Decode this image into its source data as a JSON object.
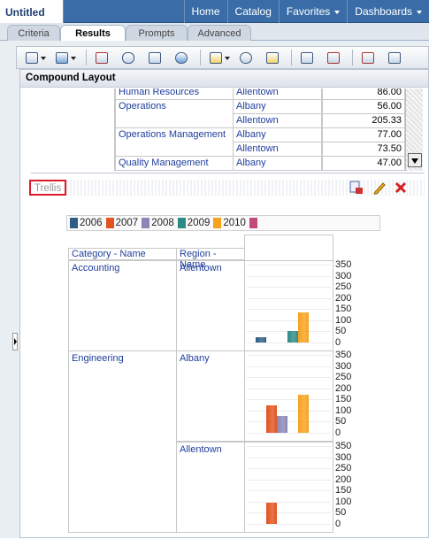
{
  "header": {
    "doc_title": "Untitled",
    "nav": [
      "Home",
      "Catalog",
      "Favorites",
      "Dashboards"
    ]
  },
  "tabs": [
    "Criteria",
    "Results",
    "Prompts",
    "Advanced"
  ],
  "compound": {
    "title": "Compound Layout",
    "rows": [
      {
        "category": "Human Resources",
        "region": "Allentown",
        "value": "86.00"
      },
      {
        "category": "Operations",
        "region": "Albany",
        "value": "56.00"
      },
      {
        "category": "",
        "region": "Allentown",
        "value": "205.33"
      },
      {
        "category": "Operations Management",
        "region": "Albany",
        "value": "77.00"
      },
      {
        "category": "",
        "region": "Allentown",
        "value": "73.50"
      },
      {
        "category": "Quality Management",
        "region": "Albany",
        "value": "47.00"
      }
    ]
  },
  "trellis": {
    "label": "Trellis",
    "legend": [
      "2006",
      "2007",
      "2008",
      "2009",
      "2010"
    ],
    "headers": {
      "category": "Category - Name",
      "region": "Region - Name"
    },
    "axis_ticks": [
      "350",
      "300",
      "250",
      "200",
      "150",
      "100",
      "50",
      "0"
    ],
    "cells": [
      {
        "category": "Accounting",
        "region": "Allentown"
      },
      {
        "category": "Engineering",
        "region": "Albany"
      },
      {
        "category": "",
        "region": "Allentown"
      }
    ]
  },
  "colors": {
    "y2006": "#2f5c86",
    "y2007": "#e2531f",
    "y2008": "#8a86b6",
    "y2009": "#2d8b85",
    "y2010": "#f7a11c",
    "y2011": "#c24a7a"
  },
  "chart_data": [
    {
      "type": "bar",
      "categories": [
        "2006",
        "2007",
        "2008",
        "2009",
        "2010"
      ],
      "series": [
        {
          "values": [
            25,
            0,
            0,
            50,
            135
          ]
        }
      ],
      "ylim": [
        0,
        350
      ]
    },
    {
      "type": "bar",
      "categories": [
        "2006",
        "2007",
        "2008",
        "2009",
        "2010"
      ],
      "series": [
        {
          "values": [
            0,
            125,
            75,
            0,
            170
          ]
        }
      ],
      "ylim": [
        0,
        350
      ]
    },
    {
      "type": "bar",
      "categories": [
        "2006",
        "2007",
        "2008",
        "2009",
        "2010"
      ],
      "series": [
        {
          "values": [
            0,
            95,
            0,
            0,
            0
          ]
        }
      ],
      "ylim": [
        0,
        350
      ]
    }
  ]
}
